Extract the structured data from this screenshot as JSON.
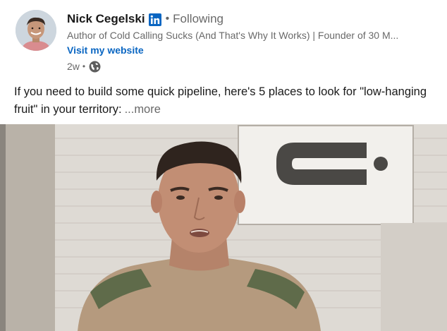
{
  "author": {
    "name": "Nick Cegelski",
    "badge_icon": "linkedin-icon",
    "separator": "•",
    "follow_status": "Following",
    "headline": "Author of Cold Calling Sucks (And That's Why It Works) | Founder of 30 M...",
    "website_label": "Visit my website",
    "timestamp": "2w",
    "time_separator": "•",
    "visibility_icon": "globe-icon"
  },
  "post": {
    "text": "If you need to build some quick pipeline, here's 5 places to look for \"low-hanging fruit\" in your territory:",
    "see_more_label": "...more"
  },
  "colors": {
    "link": "#0a66c2",
    "linkedin_brand": "#0a66c2",
    "text_primary": "#1d1d1d",
    "text_secondary": "#666666"
  }
}
